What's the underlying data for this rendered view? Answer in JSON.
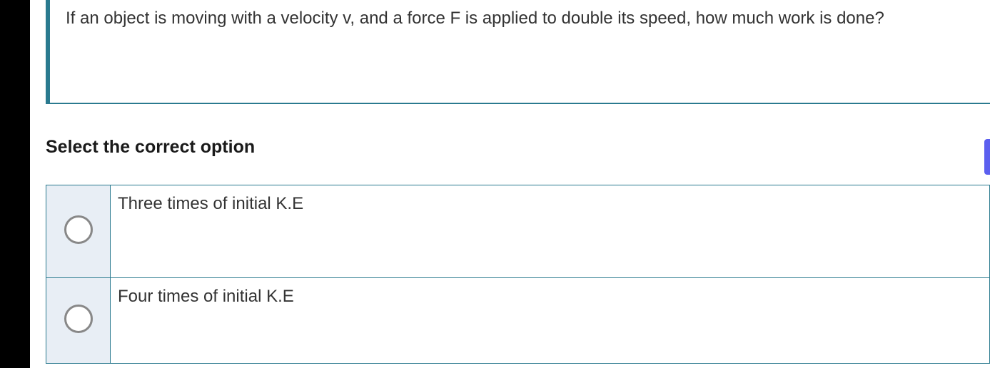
{
  "question": {
    "text": "If an object is moving with a velocity v, and a force F is applied to double its speed, how much work is done?"
  },
  "prompt": {
    "label": "Select the correct option"
  },
  "options": [
    {
      "label": "Three times of initial K.E"
    },
    {
      "label": "Four times of initial K.E"
    }
  ]
}
